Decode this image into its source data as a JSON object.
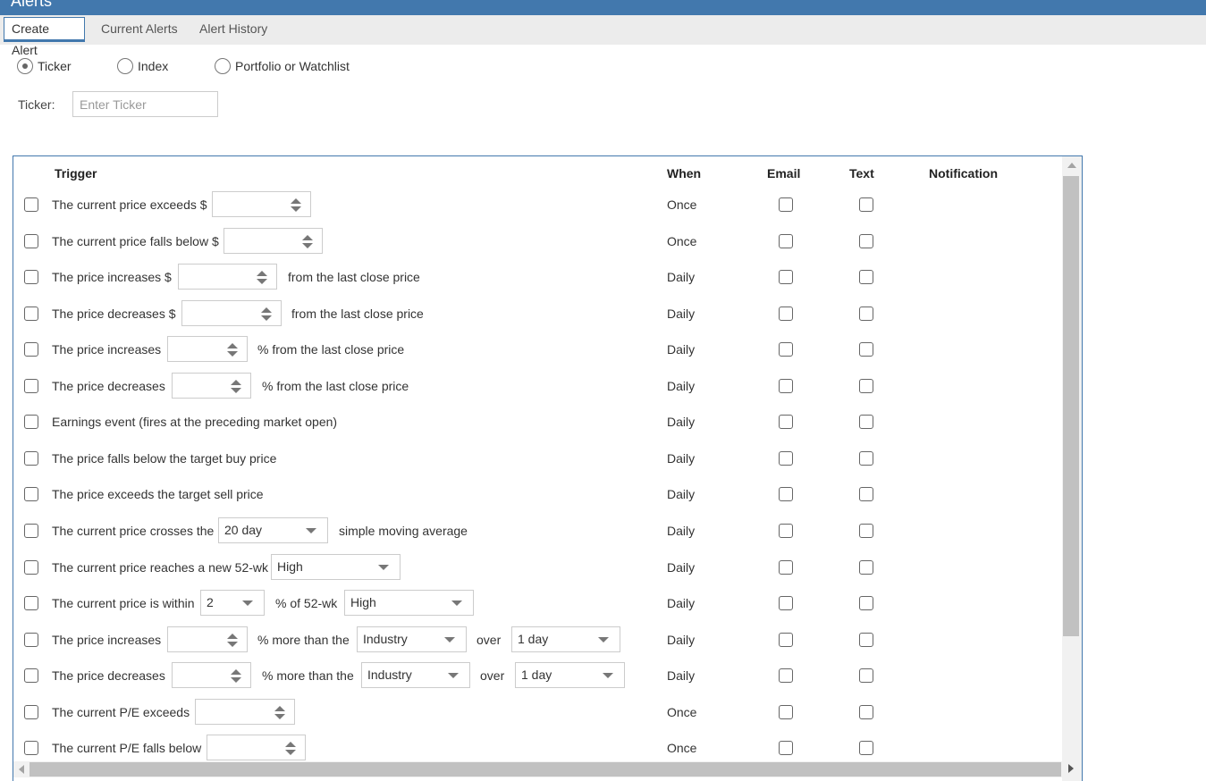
{
  "window": {
    "title": "Alerts"
  },
  "tabs": [
    {
      "label": "Create Alert",
      "active": true
    },
    {
      "label": "Current Alerts",
      "active": false
    },
    {
      "label": "Alert History",
      "active": false
    }
  ],
  "target_type": {
    "options": [
      "Ticker",
      "Index",
      "Portfolio or Watchlist"
    ],
    "selected": "Ticker"
  },
  "ticker": {
    "label": "Ticker:",
    "placeholder": "Enter Ticker",
    "value": ""
  },
  "table": {
    "headers": {
      "trigger": "Trigger",
      "when": "When",
      "email": "Email",
      "text": "Text",
      "notification": "Notification"
    },
    "rows": [
      {
        "parts": [
          "The current price exceeds $"
        ],
        "fields": [
          {
            "type": "number",
            "value": ""
          }
        ],
        "when": "Once"
      },
      {
        "parts": [
          "The current price falls below $"
        ],
        "fields": [
          {
            "type": "number",
            "value": ""
          }
        ],
        "when": "Once"
      },
      {
        "parts": [
          "The price increases $",
          "from the last close price"
        ],
        "fields": [
          {
            "type": "number",
            "value": ""
          }
        ],
        "when": "Daily"
      },
      {
        "parts": [
          "The price decreases $",
          "from the last close price"
        ],
        "fields": [
          {
            "type": "number",
            "value": ""
          }
        ],
        "when": "Daily"
      },
      {
        "parts": [
          "The price increases",
          "% from the last close price"
        ],
        "fields": [
          {
            "type": "number",
            "value": ""
          }
        ],
        "when": "Daily"
      },
      {
        "parts": [
          "The price decreases",
          "% from the last close price"
        ],
        "fields": [
          {
            "type": "number",
            "value": ""
          }
        ],
        "when": "Daily"
      },
      {
        "parts": [
          "Earnings event (fires at the preceding market open)"
        ],
        "fields": [],
        "when": "Daily"
      },
      {
        "parts": [
          "The price falls below the target buy price"
        ],
        "fields": [],
        "when": "Daily"
      },
      {
        "parts": [
          "The price exceeds the target sell price"
        ],
        "fields": [],
        "when": "Daily"
      },
      {
        "parts": [
          "The current price crosses the",
          "simple moving average"
        ],
        "fields": [
          {
            "type": "select",
            "value": "20 day"
          }
        ],
        "when": "Daily"
      },
      {
        "parts": [
          "The current price reaches a new 52-wk"
        ],
        "fields": [
          {
            "type": "select",
            "value": "High"
          }
        ],
        "when": "Daily"
      },
      {
        "parts": [
          "The current price is within",
          "% of 52-wk"
        ],
        "fields": [
          {
            "type": "select",
            "value": "2"
          },
          {
            "type": "select",
            "value": "High"
          }
        ],
        "when": "Daily"
      },
      {
        "parts": [
          "The price increases",
          "% more than the",
          "over"
        ],
        "fields": [
          {
            "type": "number",
            "value": ""
          },
          {
            "type": "select",
            "value": "Industry"
          },
          {
            "type": "select",
            "value": "1 day"
          }
        ],
        "when": "Daily"
      },
      {
        "parts": [
          "The price decreases",
          "% more than the",
          "over"
        ],
        "fields": [
          {
            "type": "number",
            "value": ""
          },
          {
            "type": "select",
            "value": "Industry"
          },
          {
            "type": "select",
            "value": "1 day"
          }
        ],
        "when": "Daily"
      },
      {
        "parts": [
          "The current P/E exceeds"
        ],
        "fields": [
          {
            "type": "number",
            "value": ""
          }
        ],
        "when": "Once"
      },
      {
        "parts": [
          "The current P/E falls below"
        ],
        "fields": [
          {
            "type": "number",
            "value": ""
          }
        ],
        "when": "Once"
      }
    ]
  },
  "colors": {
    "accent": "#4278ad",
    "tab_strip": "#ececec",
    "scrollbar_thumb": "#c1c1c1"
  }
}
